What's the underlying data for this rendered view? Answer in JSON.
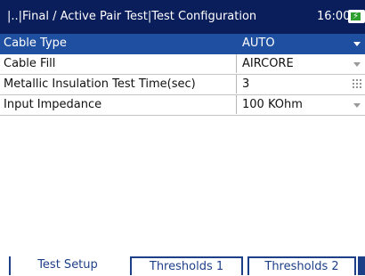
{
  "header": {
    "breadcrumb": "|..|Final / Active Pair Test|Test Configuration",
    "time": "16:00",
    "battery_icon": "battery-charging-icon"
  },
  "settings": [
    {
      "label": "Cable Type",
      "value": "AUTO",
      "control": "dropdown"
    },
    {
      "label": "Cable Fill",
      "value": "AIRCORE",
      "control": "dropdown"
    },
    {
      "label": "Metallic Insulation Test Time(sec)",
      "value": "3",
      "control": "keypad"
    },
    {
      "label": "Input Impedance",
      "value": "100 KOhm",
      "control": "dropdown"
    }
  ],
  "tabs": [
    {
      "label": "Test Setup",
      "active": true
    },
    {
      "label": "Thresholds 1",
      "active": false
    },
    {
      "label": "Thresholds 2",
      "active": false
    }
  ],
  "colors": {
    "title_bar": "#0b1e5c",
    "selection": "#1f4fa0",
    "tab_accent": "#1d3f88"
  }
}
